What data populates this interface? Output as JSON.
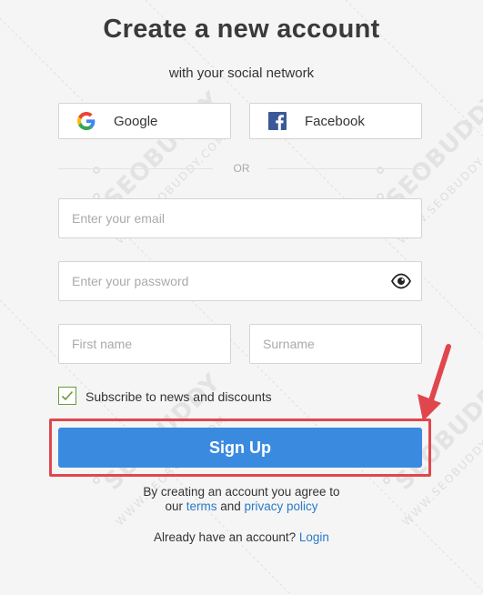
{
  "header": {
    "title": "Create a new account",
    "subtitle": "with your social network"
  },
  "social": {
    "google_label": "Google",
    "facebook_label": "Facebook"
  },
  "divider": {
    "text": "OR"
  },
  "form": {
    "email_placeholder": "Enter your email",
    "password_placeholder": "Enter your password",
    "first_name_placeholder": "First name",
    "surname_placeholder": "Surname",
    "subscribe_label": "Subscribe to news and discounts",
    "subscribe_checked": true,
    "signup_label": "Sign Up"
  },
  "agreement": {
    "line1": "By creating an account you agree to",
    "prefix": "our",
    "terms_link": "terms",
    "and": "and",
    "privacy_link": "privacy policy"
  },
  "login": {
    "prompt": "Already have an account?",
    "link": "Login"
  },
  "watermark": {
    "brand": "SEOBUDDY",
    "site": "WWW.SEOBUDDY.COM"
  },
  "colors": {
    "primary_button": "#3a8be0",
    "highlight": "#e0474c",
    "link": "#2a7ac8",
    "checkbox": "#6a9a3a",
    "facebook": "#3b5998"
  }
}
